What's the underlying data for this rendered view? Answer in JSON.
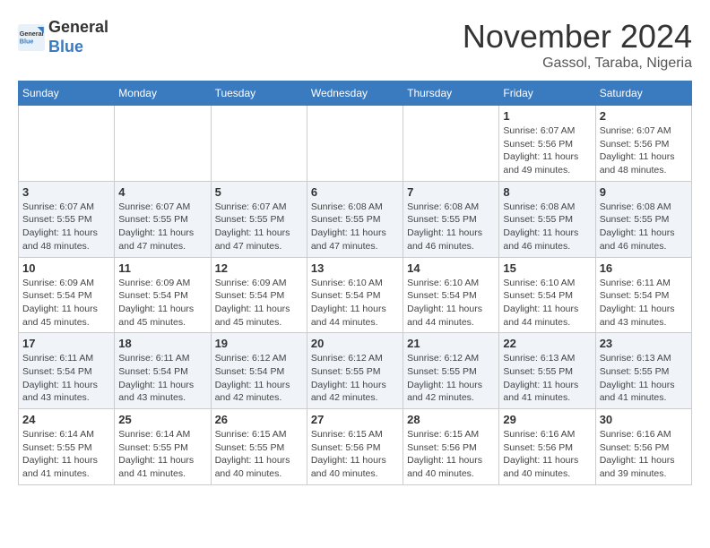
{
  "header": {
    "logo_general": "General",
    "logo_blue": "Blue",
    "month": "November 2024",
    "location": "Gassol, Taraba, Nigeria"
  },
  "calendar": {
    "days_of_week": [
      "Sunday",
      "Monday",
      "Tuesday",
      "Wednesday",
      "Thursday",
      "Friday",
      "Saturday"
    ],
    "weeks": [
      [
        {
          "day": "",
          "info": ""
        },
        {
          "day": "",
          "info": ""
        },
        {
          "day": "",
          "info": ""
        },
        {
          "day": "",
          "info": ""
        },
        {
          "day": "",
          "info": ""
        },
        {
          "day": "1",
          "info": "Sunrise: 6:07 AM\nSunset: 5:56 PM\nDaylight: 11 hours\nand 49 minutes."
        },
        {
          "day": "2",
          "info": "Sunrise: 6:07 AM\nSunset: 5:56 PM\nDaylight: 11 hours\nand 48 minutes."
        }
      ],
      [
        {
          "day": "3",
          "info": "Sunrise: 6:07 AM\nSunset: 5:55 PM\nDaylight: 11 hours\nand 48 minutes."
        },
        {
          "day": "4",
          "info": "Sunrise: 6:07 AM\nSunset: 5:55 PM\nDaylight: 11 hours\nand 47 minutes."
        },
        {
          "day": "5",
          "info": "Sunrise: 6:07 AM\nSunset: 5:55 PM\nDaylight: 11 hours\nand 47 minutes."
        },
        {
          "day": "6",
          "info": "Sunrise: 6:08 AM\nSunset: 5:55 PM\nDaylight: 11 hours\nand 47 minutes."
        },
        {
          "day": "7",
          "info": "Sunrise: 6:08 AM\nSunset: 5:55 PM\nDaylight: 11 hours\nand 46 minutes."
        },
        {
          "day": "8",
          "info": "Sunrise: 6:08 AM\nSunset: 5:55 PM\nDaylight: 11 hours\nand 46 minutes."
        },
        {
          "day": "9",
          "info": "Sunrise: 6:08 AM\nSunset: 5:55 PM\nDaylight: 11 hours\nand 46 minutes."
        }
      ],
      [
        {
          "day": "10",
          "info": "Sunrise: 6:09 AM\nSunset: 5:54 PM\nDaylight: 11 hours\nand 45 minutes."
        },
        {
          "day": "11",
          "info": "Sunrise: 6:09 AM\nSunset: 5:54 PM\nDaylight: 11 hours\nand 45 minutes."
        },
        {
          "day": "12",
          "info": "Sunrise: 6:09 AM\nSunset: 5:54 PM\nDaylight: 11 hours\nand 45 minutes."
        },
        {
          "day": "13",
          "info": "Sunrise: 6:10 AM\nSunset: 5:54 PM\nDaylight: 11 hours\nand 44 minutes."
        },
        {
          "day": "14",
          "info": "Sunrise: 6:10 AM\nSunset: 5:54 PM\nDaylight: 11 hours\nand 44 minutes."
        },
        {
          "day": "15",
          "info": "Sunrise: 6:10 AM\nSunset: 5:54 PM\nDaylight: 11 hours\nand 44 minutes."
        },
        {
          "day": "16",
          "info": "Sunrise: 6:11 AM\nSunset: 5:54 PM\nDaylight: 11 hours\nand 43 minutes."
        }
      ],
      [
        {
          "day": "17",
          "info": "Sunrise: 6:11 AM\nSunset: 5:54 PM\nDaylight: 11 hours\nand 43 minutes."
        },
        {
          "day": "18",
          "info": "Sunrise: 6:11 AM\nSunset: 5:54 PM\nDaylight: 11 hours\nand 43 minutes."
        },
        {
          "day": "19",
          "info": "Sunrise: 6:12 AM\nSunset: 5:54 PM\nDaylight: 11 hours\nand 42 minutes."
        },
        {
          "day": "20",
          "info": "Sunrise: 6:12 AM\nSunset: 5:55 PM\nDaylight: 11 hours\nand 42 minutes."
        },
        {
          "day": "21",
          "info": "Sunrise: 6:12 AM\nSunset: 5:55 PM\nDaylight: 11 hours\nand 42 minutes."
        },
        {
          "day": "22",
          "info": "Sunrise: 6:13 AM\nSunset: 5:55 PM\nDaylight: 11 hours\nand 41 minutes."
        },
        {
          "day": "23",
          "info": "Sunrise: 6:13 AM\nSunset: 5:55 PM\nDaylight: 11 hours\nand 41 minutes."
        }
      ],
      [
        {
          "day": "24",
          "info": "Sunrise: 6:14 AM\nSunset: 5:55 PM\nDaylight: 11 hours\nand 41 minutes."
        },
        {
          "day": "25",
          "info": "Sunrise: 6:14 AM\nSunset: 5:55 PM\nDaylight: 11 hours\nand 41 minutes."
        },
        {
          "day": "26",
          "info": "Sunrise: 6:15 AM\nSunset: 5:55 PM\nDaylight: 11 hours\nand 40 minutes."
        },
        {
          "day": "27",
          "info": "Sunrise: 6:15 AM\nSunset: 5:56 PM\nDaylight: 11 hours\nand 40 minutes."
        },
        {
          "day": "28",
          "info": "Sunrise: 6:15 AM\nSunset: 5:56 PM\nDaylight: 11 hours\nand 40 minutes."
        },
        {
          "day": "29",
          "info": "Sunrise: 6:16 AM\nSunset: 5:56 PM\nDaylight: 11 hours\nand 40 minutes."
        },
        {
          "day": "30",
          "info": "Sunrise: 6:16 AM\nSunset: 5:56 PM\nDaylight: 11 hours\nand 39 minutes."
        }
      ]
    ]
  }
}
